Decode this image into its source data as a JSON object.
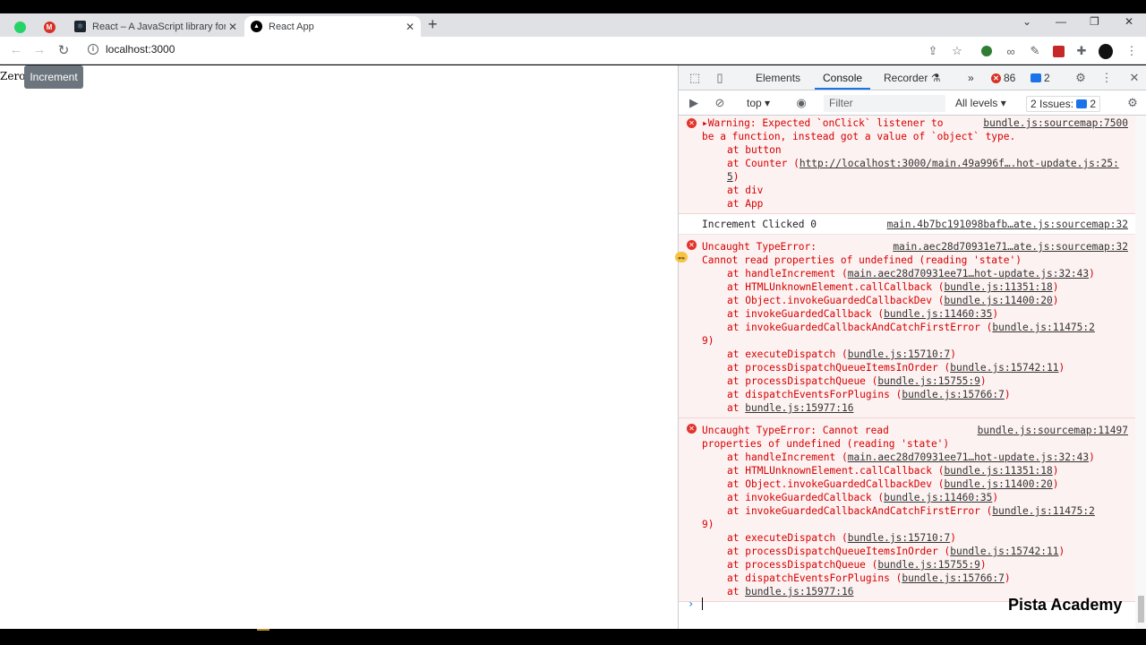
{
  "browser": {
    "tabs": [
      {
        "title": "React – A JavaScript library for bu",
        "close": "✕"
      },
      {
        "title": "React App",
        "close": "✕"
      }
    ],
    "new_tab": "+",
    "url": "localhost:3000",
    "window_controls": {
      "minimize": "—",
      "restore": "❐",
      "close": "✕"
    }
  },
  "page": {
    "text": "Zero",
    "tooltip_button": "Increment"
  },
  "devtools": {
    "tabs": [
      "Elements",
      "Console",
      "Recorder"
    ],
    "more_tabs": "»",
    "error_count": "86",
    "message_count": "2",
    "context": "top",
    "filter_placeholder": "Filter",
    "levels": "All levels",
    "issues_label": "2 Issues:",
    "issues_count": "2"
  },
  "console": {
    "warning": {
      "source": "bundle.js:sourcemap:7500",
      "text_line1": "Warning: Expected `onClick` listener to",
      "text_line2": "be a function, instead got a value of `object` type.",
      "stack": [
        {
          "at": "at button",
          "link": ""
        },
        {
          "at": "at Counter (",
          "link": "http://localhost:3000/main.49a996f….hot-update.js:25:5",
          "end": ")"
        },
        {
          "at": "at div",
          "link": ""
        },
        {
          "at": "at App",
          "link": ""
        }
      ]
    },
    "log": {
      "text": "Increment Clicked 0",
      "source": "main.4b7bc191098bafb…ate.js:sourcemap:32"
    },
    "error1": {
      "source": "main.aec28d70931e71…ate.js:sourcemap:32",
      "line1": "Uncaught TypeError:",
      "line2": "Cannot read properties of undefined (reading 'state')",
      "stack": [
        {
          "at": "at handleIncrement (",
          "link": "main.aec28d70931ee71…hot-update.js:32:43",
          "end": ")"
        },
        {
          "at": "at HTMLUnknownElement.callCallback (",
          "link": "bundle.js:11351:18",
          "end": ")"
        },
        {
          "at": "at Object.invokeGuardedCallbackDev (",
          "link": "bundle.js:11400:20",
          "end": ")"
        },
        {
          "at": "at invokeGuardedCallback (",
          "link": "bundle.js:11460:35",
          "end": ")"
        },
        {
          "at": "at invokeGuardedCallbackAndCatchFirstError (",
          "link": "bundle.js:11475:2",
          "end": ""
        },
        {
          "at": "9)",
          "link": "",
          "end": "",
          "cont": true
        },
        {
          "at": "at executeDispatch (",
          "link": "bundle.js:15710:7",
          "end": ")"
        },
        {
          "at": "at processDispatchQueueItemsInOrder (",
          "link": "bundle.js:15742:11",
          "end": ")"
        },
        {
          "at": "at processDispatchQueue (",
          "link": "bundle.js:15755:9",
          "end": ")"
        },
        {
          "at": "at dispatchEventsForPlugins (",
          "link": "bundle.js:15766:7",
          "end": ")"
        },
        {
          "at": "at ",
          "link": "bundle.js:15977:16",
          "end": ""
        }
      ]
    },
    "error2": {
      "source": "bundle.js:sourcemap:11497",
      "line1": "Uncaught TypeError: Cannot read",
      "line2": "properties of undefined (reading 'state')",
      "stack": [
        {
          "at": "at handleIncrement (",
          "link": "main.aec28d70931ee71…hot-update.js:32:43",
          "end": ")"
        },
        {
          "at": "at HTMLUnknownElement.callCallback (",
          "link": "bundle.js:11351:18",
          "end": ")"
        },
        {
          "at": "at Object.invokeGuardedCallbackDev (",
          "link": "bundle.js:11400:20",
          "end": ")"
        },
        {
          "at": "at invokeGuardedCallback (",
          "link": "bundle.js:11460:35",
          "end": ")"
        },
        {
          "at": "at invokeGuardedCallbackAndCatchFirstError (",
          "link": "bundle.js:11475:2",
          "end": ""
        },
        {
          "at": "9)",
          "link": "",
          "end": "",
          "cont": true
        },
        {
          "at": "at executeDispatch (",
          "link": "bundle.js:15710:7",
          "end": ")"
        },
        {
          "at": "at processDispatchQueueItemsInOrder (",
          "link": "bundle.js:15742:11",
          "end": ")"
        },
        {
          "at": "at processDispatchQueue (",
          "link": "bundle.js:15755:9",
          "end": ")"
        },
        {
          "at": "at dispatchEventsForPlugins (",
          "link": "bundle.js:15766:7",
          "end": ")"
        },
        {
          "at": "at ",
          "link": "bundle.js:15977:16",
          "end": ""
        }
      ]
    }
  },
  "watermark": "Pista Academy",
  "colors": {
    "error_text": "#d60000",
    "error_bg": "#fdf2f2",
    "accent": "#1a73e8",
    "button_bg": "#6c757d"
  }
}
